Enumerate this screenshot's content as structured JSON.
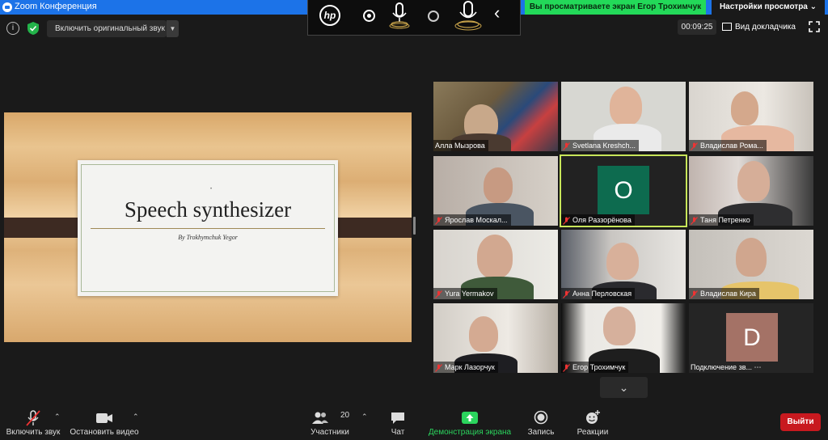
{
  "window": {
    "title": "Zoom Конференция"
  },
  "share": {
    "banner": "Вы просматриваете экран Егор Трохимчук",
    "view_options": "Настройки просмотра ⌄"
  },
  "controls": {
    "original_sound": "Включить оригинальный звук",
    "timer": "00:09:25",
    "view_mode": "Вид докладчика"
  },
  "hp_toolbar": {
    "logo": "hp"
  },
  "slide": {
    "title": "Speech synthesizer",
    "subtitle": "By Trokhymchuk Yegor"
  },
  "participants": [
    {
      "name": "Алла Мызрова",
      "muted": false
    },
    {
      "name": "Svetlana Kreshch...",
      "muted": true
    },
    {
      "name": "Владислав Рома...",
      "muted": true
    },
    {
      "name": "Ярослав Москал...",
      "muted": true
    },
    {
      "name": "Оля Раззорёнова",
      "muted": true,
      "avatar_letter": "O",
      "avatar_color": "#0d6b4f",
      "active": true
    },
    {
      "name": "Таня Петренко",
      "muted": true
    },
    {
      "name": "Yura Yermakov",
      "muted": true
    },
    {
      "name": "Анна Перловская",
      "muted": true
    },
    {
      "name": "Владислав Кира",
      "muted": true
    },
    {
      "name": "Марк Лазорчук",
      "muted": true
    },
    {
      "name": "Егор Трохимчук",
      "muted": true
    },
    {
      "name": "Подключение зв...",
      "muted": false,
      "avatar_letter": "D",
      "avatar_color": "#a47266"
    }
  ],
  "toolbar": {
    "unmute": "Включить звук",
    "stop_video": "Остановить видео",
    "participants": "Участники",
    "participants_count": "20",
    "chat": "Чат",
    "share_screen": "Демонстрация экрана",
    "record": "Запись",
    "reactions": "Реакции",
    "leave": "Выйти"
  },
  "colors": {
    "accent": "#1c73e8",
    "share_green": "#23d959",
    "leave_red": "#c8191f",
    "active_border": "#c8e65a"
  }
}
